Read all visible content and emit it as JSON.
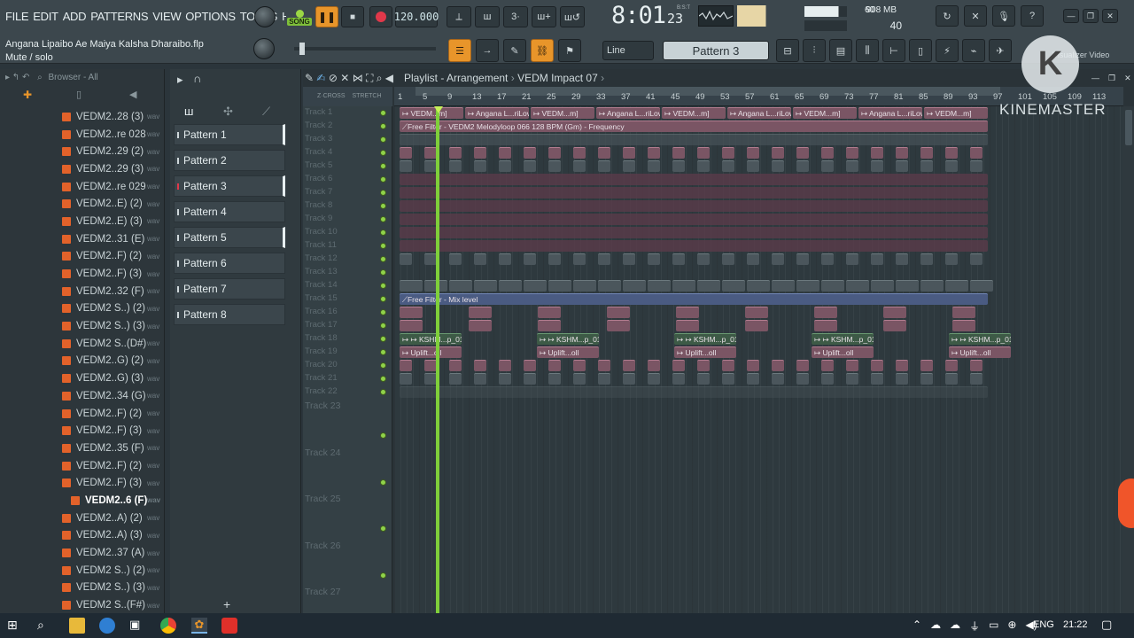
{
  "menu": [
    "FILE",
    "EDIT",
    "ADD",
    "PATTERNS",
    "VIEW",
    "OPTIONS",
    "TOOLS",
    "HELP"
  ],
  "transport": {
    "song_label": "SONG",
    "tempo": "120.000",
    "time": "8:01",
    "time_sub": "23",
    "time_unit": "B:S:T"
  },
  "perf": {
    "cpu_value": "60",
    "memory": "908 MB",
    "polyphony": "40"
  },
  "hint": {
    "project_file": "Angana Lipaibo Ae Maiya Kalsha Dharaibo.flp",
    "hint_text": "Mute / solo"
  },
  "toolbar2": {
    "snap": "Line",
    "pattern_selector": "Pattern 3",
    "visualizer_label": "Visualizer Video"
  },
  "browser": {
    "header": "Browser - All",
    "items": [
      {
        "name": "VEDM2..28 (3)",
        "ext": "wav"
      },
      {
        "name": "VEDM2..re 028",
        "ext": "wav"
      },
      {
        "name": "VEDM2..29 (2)",
        "ext": "wav"
      },
      {
        "name": "VEDM2..29 (3)",
        "ext": "wav"
      },
      {
        "name": "VEDM2..re 029",
        "ext": "wav"
      },
      {
        "name": "VEDM2..E) (2)",
        "ext": "wav"
      },
      {
        "name": "VEDM2..E) (3)",
        "ext": "wav"
      },
      {
        "name": "VEDM2..31 (E)",
        "ext": "wav"
      },
      {
        "name": "VEDM2..F) (2)",
        "ext": "wav"
      },
      {
        "name": "VEDM2..F) (3)",
        "ext": "wav"
      },
      {
        "name": "VEDM2..32 (F)",
        "ext": "wav"
      },
      {
        "name": "VEDM2 S..) (2)",
        "ext": "wav"
      },
      {
        "name": "VEDM2 S..) (3)",
        "ext": "wav"
      },
      {
        "name": "VEDM2 S..(D#)",
        "ext": "wav"
      },
      {
        "name": "VEDM2..G) (2)",
        "ext": "wav"
      },
      {
        "name": "VEDM2..G) (3)",
        "ext": "wav"
      },
      {
        "name": "VEDM2..34 (G)",
        "ext": "wav"
      },
      {
        "name": "VEDM2..F) (2)",
        "ext": "wav"
      },
      {
        "name": "VEDM2..F) (3)",
        "ext": "wav"
      },
      {
        "name": "VEDM2..35 (F)",
        "ext": "wav"
      },
      {
        "name": "VEDM2..F) (2)",
        "ext": "wav"
      },
      {
        "name": "VEDM2..F) (3)",
        "ext": "wav"
      },
      {
        "name": "VEDM2..6 (F)",
        "ext": "wav",
        "selected": true
      },
      {
        "name": "VEDM2..A) (2)",
        "ext": "wav"
      },
      {
        "name": "VEDM2..A) (3)",
        "ext": "wav"
      },
      {
        "name": "VEDM2..37 (A)",
        "ext": "wav"
      },
      {
        "name": "VEDM2 S..) (2)",
        "ext": "wav"
      },
      {
        "name": "VEDM2 S..) (3)",
        "ext": "wav"
      },
      {
        "name": "VEDM2 S..(F#)",
        "ext": "wav"
      }
    ]
  },
  "patterns": [
    "Pattern 1",
    "Pattern 2",
    "Pattern 3",
    "Pattern 4",
    "Pattern 5",
    "Pattern 6",
    "Pattern 7",
    "Pattern 8"
  ],
  "playlist": {
    "title": "Playlist - Arrangement",
    "arrangement": "VEDM Impact 07",
    "ruler": [
      "1",
      "5",
      "9",
      "13",
      "17",
      "21",
      "25",
      "29",
      "33",
      "37",
      "41",
      "45",
      "49",
      "53",
      "57",
      "61",
      "65",
      "69",
      "73",
      "77",
      "81",
      "85",
      "89",
      "93",
      "97",
      "101",
      "105",
      "109",
      "113"
    ],
    "tracks": [
      "Track 1",
      "Track 2",
      "Track 3",
      "Track 4",
      "Track 5",
      "Track 6",
      "Track 7",
      "Track 8",
      "Track 9",
      "Track 10",
      "Track 11",
      "Track 12",
      "Track 13",
      "Track 14",
      "Track 15",
      "Track 16",
      "Track 17",
      "Track 18",
      "Track 19",
      "Track 20",
      "Track 21",
      "Track 22"
    ],
    "big_tracks": [
      "Track 23",
      "Track 24",
      "Track 25",
      "Track 26",
      "Track 27"
    ],
    "track1_clips": [
      "VEDM...m]",
      "Angana L...riLove.IN]",
      "VEDM...m]",
      "Angana L...riLove.IN]",
      "VEDM...m]",
      "Angana L...riLove.IN]",
      "VEDM...m]",
      "Angana L...riLove.IN]",
      "VEDM...m]"
    ],
    "track2_clip": "Free Filter - VEDM2 Melodyloop 066 128 BPM (Gm) - Frequency",
    "track15_clip": "Free Filter - Mix level",
    "track18_clip": "KSHM...p_01",
    "track19_clip": "Uplift...oll"
  },
  "watermark": "KINEMASTER",
  "taskbar": {
    "lang": "ENG",
    "clock": "21:22"
  }
}
